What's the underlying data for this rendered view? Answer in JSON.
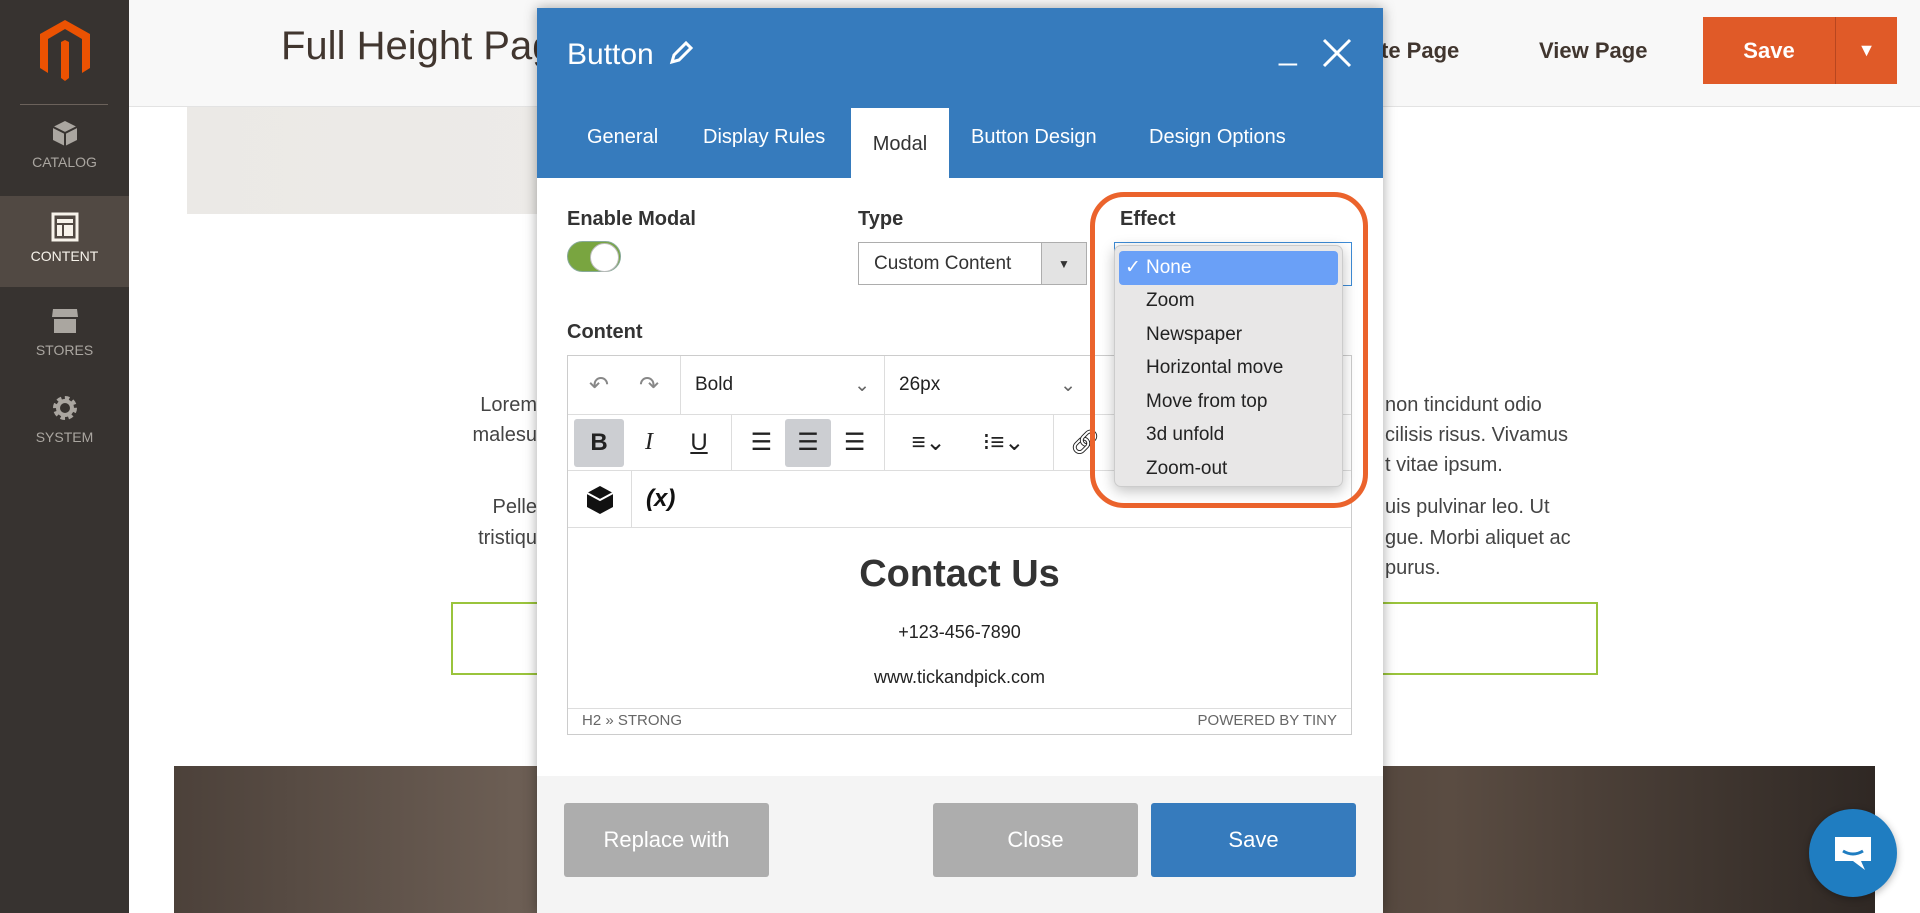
{
  "sidebar": {
    "items": [
      {
        "label": "CATALOG",
        "icon": "cube-icon"
      },
      {
        "label": "CONTENT",
        "icon": "layout-icon",
        "active": true
      },
      {
        "label": "STORES",
        "icon": "storefront-icon"
      },
      {
        "label": "SYSTEM",
        "icon": "gear-icon"
      }
    ]
  },
  "header": {
    "title": "Full Height Page - Tic",
    "link1": "te Page",
    "link2": "View Page",
    "save": "Save",
    "save_arrow": "▼"
  },
  "background": {
    "left": [
      "Lorem",
      "malesu",
      "Pelle",
      "tristiqu"
    ],
    "right": [
      "non tincidunt odio",
      "cilisis risus. Vivamus",
      "t vitae ipsum.",
      "uis pulvinar leo. Ut",
      "gue. Morbi aliquet ac",
      "purus."
    ]
  },
  "modal": {
    "title": "Button",
    "tabs": [
      "General",
      "Display Rules",
      "Modal",
      "Button Design",
      "Design Options"
    ],
    "active_tab": "Modal",
    "enable_modal_label": "Enable Modal",
    "enable_modal": true,
    "type_label": "Type",
    "type_value": "Custom Content",
    "effect_label": "Effect",
    "effect_options": [
      "None",
      "Zoom",
      "Newspaper",
      "Horizontal move",
      "Move from top",
      "3d unfold",
      "Zoom-out"
    ],
    "effect_selected": "None",
    "check": "✓",
    "content_label": "Content",
    "editor": {
      "block_format": "Bold",
      "font_size": "26px",
      "variable": "(x)",
      "heading": "Contact Us",
      "phone": "+123-456-7890",
      "website": "www.tickandpick.com",
      "path": "H2 » STRONG",
      "powered": "POWERED BY TINY"
    },
    "buttons": {
      "replace": "Replace with",
      "close": "Close",
      "save": "Save"
    }
  },
  "colors": {
    "accent": "#367bbd",
    "orange": "#e05a28",
    "highlight": "#eb632c",
    "toggle_on": "#79a540"
  }
}
